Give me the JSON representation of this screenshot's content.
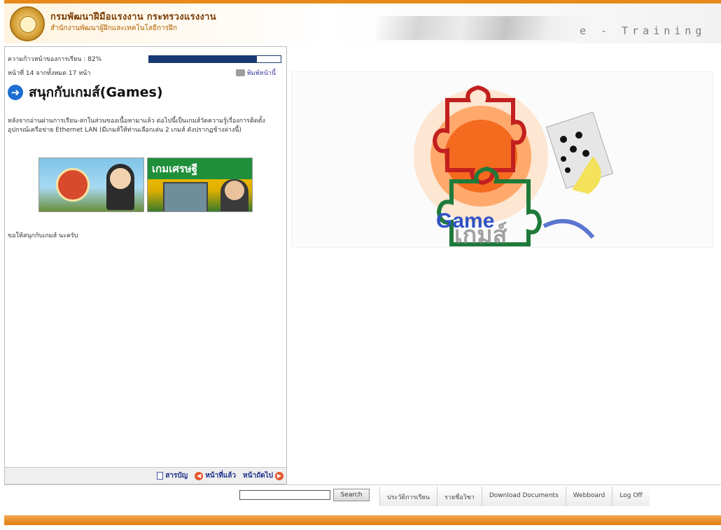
{
  "header": {
    "org_title": "กรมพัฒนาฝีมือแรงงาน กระทรวงแรงงาน",
    "org_subtitle": "สำนักงานพัฒนาผู้ฝึกและเทคโนโลยีการฝึก",
    "brand_text": "e - Training"
  },
  "lesson": {
    "progress_label": "ความก้าวหน้าของการเรียน : 82%",
    "progress_value": 0.82,
    "page_label": "หน้าที่ 14 จากทั้งหมด 17 หน้า",
    "print_label": "พิมพ์หน้านี้",
    "title": "สนุกกับเกมส์(Games)",
    "intro_text": "หลังจากอ่านผ่านการเรียน-สกในส่วนของเนื้อหามาแล้ว ต่อไปนี้เป็นเกมส์วัดความรู้เรื่องการติดตั้งอุปกรณ์เครือข่าย Ethernet LAN (มีเกมส์ให้ท่านเลือกเล่น 2 เกมส์ ดังปรากฏข้างล่างนี้)",
    "thumb2_banner": "เกมเศรษฐี",
    "closing_text": "ขอให้สนุกกับเกมส์ นะครับ"
  },
  "nav": {
    "toc_label": "สารบัญ",
    "prev_label": "หน้าที่แล้ว",
    "next_label": "หน้าถัดไป"
  },
  "right": {
    "game_title": "Game",
    "game_thai": "เกมส์"
  },
  "footer": {
    "search_placeholder": "",
    "search_button": "Search",
    "links": [
      "ประวัติการเรียน",
      "รายชื่อวิชา",
      "Download Documents",
      "Webboard",
      "Log Off"
    ]
  },
  "colors": {
    "accent_orange": "#e8891c",
    "progress_blue": "#173a75",
    "puzzle_red": "#c21f1f",
    "puzzle_green": "#1f7a3a"
  }
}
